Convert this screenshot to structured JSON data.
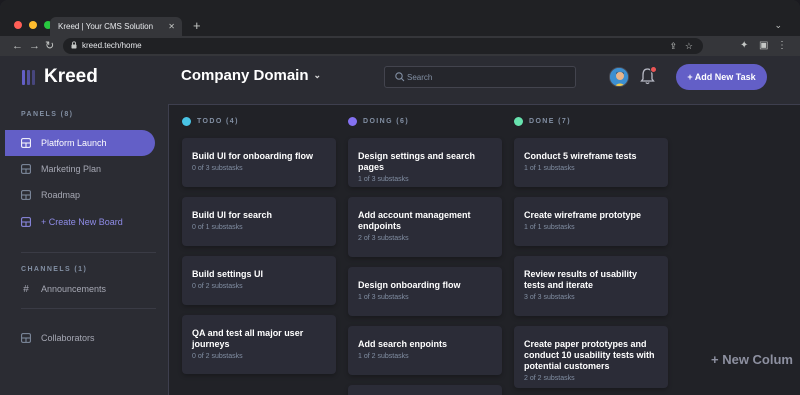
{
  "browser": {
    "tab_title": "Kreed | Your CMS Solution",
    "url": "kreed.tech/home",
    "traffic_light_colors": [
      "#ff5f57",
      "#febc2e",
      "#28c840"
    ]
  },
  "app": {
    "logo_text": "Kreed",
    "board_title": "Company Domain",
    "search_placeholder": "Search",
    "add_task_label": "+ Add New Task",
    "accent_color": "#635fc7"
  },
  "sidebar": {
    "panels_heading": "PANELS (8)",
    "boards": [
      {
        "label": "Platform Launch",
        "active": true
      },
      {
        "label": "Marketing Plan",
        "active": false
      },
      {
        "label": "Roadmap",
        "active": false
      }
    ],
    "create_label": "+ Create New Board",
    "channels_heading": "CHANNELS (1)",
    "channels": [
      {
        "label": "Announcements"
      }
    ],
    "collaborators_label": "Collaborators"
  },
  "columns": [
    {
      "name": "TODO (4)",
      "color": "#49c4e5",
      "cards": [
        {
          "title": "Build UI for onboarding flow",
          "sub": "0 of 3 substasks"
        },
        {
          "title": "Build UI for search",
          "sub": "0 of 1 substasks"
        },
        {
          "title": "Build settings UI",
          "sub": "0 of 2 substasks"
        },
        {
          "title": "QA and test all major user journeys",
          "sub": "0 of 2 substasks"
        }
      ]
    },
    {
      "name": "DOING (6)",
      "color": "#8471f2",
      "cards": [
        {
          "title": "Design settings and search pages",
          "sub": "1 of 3 substasks"
        },
        {
          "title": "Add account management endpoints",
          "sub": "2 of 3 substasks"
        },
        {
          "title": "Design onboarding flow",
          "sub": "1 of 3 substasks"
        },
        {
          "title": "Add search enpoints",
          "sub": "1 of 2 substasks"
        }
      ]
    },
    {
      "name": "DONE (7)",
      "color": "#67e2ae",
      "cards": [
        {
          "title": "Conduct 5 wireframe tests",
          "sub": "1 of 1 substasks"
        },
        {
          "title": "Create wireframe prototype",
          "sub": "1 of 1 substasks"
        },
        {
          "title": "Review results of usability tests and iterate",
          "sub": "3 of 3 substasks"
        },
        {
          "title": "Create paper prototypes and conduct 10 usability tests with potential customers",
          "sub": "2 of 2 substasks"
        }
      ]
    }
  ],
  "new_column_label": "+ New Colum"
}
